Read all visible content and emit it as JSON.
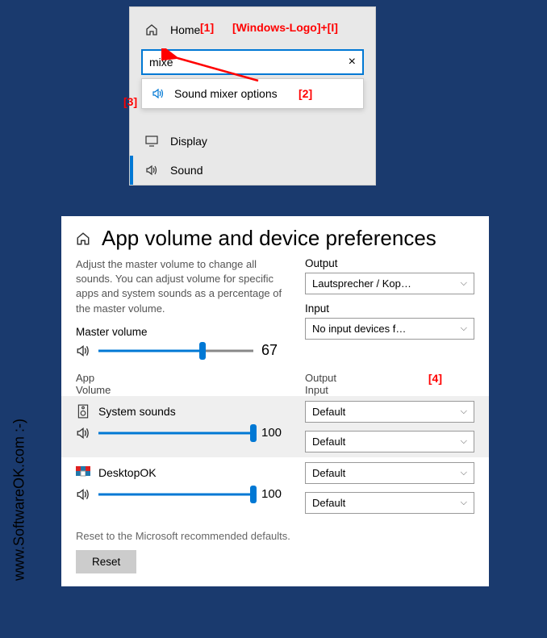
{
  "annotations": {
    "a1": "[1]",
    "a1_text": "[Windows-Logo]+[I]",
    "a2": "[2]",
    "a3": "[3]",
    "a4": "[4]"
  },
  "watermark": "www.SoftwareOK.com :-)",
  "nav": {
    "home": "Home",
    "search_value": "mixe",
    "clear": "×",
    "suggestion": "Sound mixer options",
    "display": "Display",
    "sound": "Sound"
  },
  "panel": {
    "title": "App volume and device preferences",
    "desc": "Adjust the master volume to change all sounds. You can adjust volume for specific apps and system sounds as a percentage of the master volume.",
    "master_label": "Master volume",
    "master_value": "67",
    "output_label": "Output",
    "output_value": "Lautsprecher / Kop…",
    "input_label": "Input",
    "input_value": "No input devices f…",
    "col_app": "App",
    "col_volume": "Volume",
    "col_output": "Output",
    "col_input": "Input",
    "apps": [
      {
        "name": "System sounds",
        "vol": "100",
        "output": "Default",
        "input": "Default"
      },
      {
        "name": "DesktopOK",
        "vol": "100",
        "output": "Default",
        "input": "Default"
      }
    ],
    "reset_note": "Reset to the Microsoft recommended defaults.",
    "reset_btn": "Reset"
  }
}
